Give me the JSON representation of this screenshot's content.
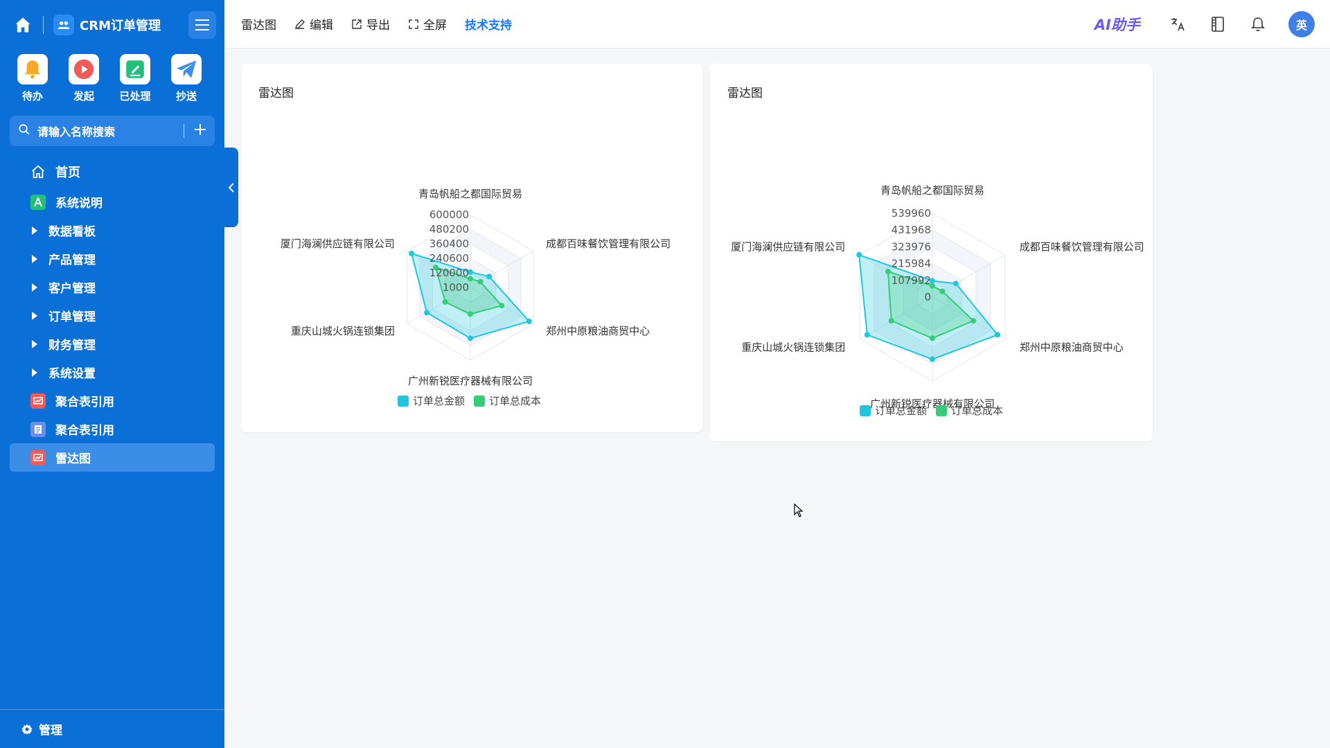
{
  "app": {
    "title": "CRM订单管理"
  },
  "quick_actions": [
    {
      "label": "待办",
      "icon": "bell-icon"
    },
    {
      "label": "发起",
      "icon": "play-icon"
    },
    {
      "label": "已处理",
      "icon": "processed-icon"
    },
    {
      "label": "抄送",
      "icon": "send-icon"
    }
  ],
  "search": {
    "placeholder": "请输入名称搜索"
  },
  "nav": [
    {
      "label": "首页",
      "icon": "home-icon"
    },
    {
      "label": "系统说明",
      "icon": "doc-a-icon"
    },
    {
      "label": "数据看板",
      "icon": "caret-right-icon"
    },
    {
      "label": "产品管理",
      "icon": "caret-right-icon"
    },
    {
      "label": "客户管理",
      "icon": "caret-right-icon"
    },
    {
      "label": "订单管理",
      "icon": "caret-right-icon"
    },
    {
      "label": "财务管理",
      "icon": "caret-right-icon"
    },
    {
      "label": "系统设置",
      "icon": "caret-right-icon"
    },
    {
      "label": "聚合表引用",
      "icon": "chart-report-icon"
    },
    {
      "label": "聚合表引用",
      "icon": "file-icon"
    },
    {
      "label": "雷达图",
      "icon": "chart-report-icon",
      "active": true
    }
  ],
  "footer": {
    "label": "管理"
  },
  "toolbar": {
    "page_title": "雷达图",
    "edit": "编辑",
    "export": "导出",
    "fullscreen": "全屏",
    "support": "技术支持",
    "ai": "AI助手",
    "avatar": "英"
  },
  "colors": {
    "sidebar": "#0b6fd8",
    "series1": "#1ec6e0",
    "series2": "#35cc7a",
    "accent": "#1677ff"
  },
  "chart_data": [
    {
      "type": "radar",
      "title": "雷达图",
      "indicators": [
        "青岛帆船之都国际贸易",
        "成都百味餐饮管理有限公司",
        "郑州中原粮油商贸中心",
        "广州新锐医疗器械有限公司",
        "重庆山城火锅连锁集团",
        "厦门海澜供应链有限公司"
      ],
      "ticks": [
        "1000",
        "120000",
        "240600",
        "360400",
        "480200",
        "600000"
      ],
      "range": [
        1000,
        600000
      ],
      "series": [
        {
          "name": "订单总金额",
          "values": [
            128000,
            180000,
            560000,
            420000,
            415000,
            560000
          ]
        },
        {
          "name": "订单总成本",
          "values": [
            73000,
            95000,
            300000,
            220000,
            240000,
            330000
          ]
        }
      ],
      "legend": "bottom"
    },
    {
      "type": "radar",
      "title": "雷达图",
      "indicators": [
        "青岛帆船之都国际贸易",
        "成都百味餐饮管理有限公司",
        "郑州中原粮油商贸中心",
        "广州新锐医疗器械有限公司",
        "重庆山城火锅连锁集团",
        "厦门海澜供应链有限公司"
      ],
      "ticks": [
        "0",
        "107992",
        "215984",
        "323976",
        "431968",
        "539960"
      ],
      "range": [
        0,
        539960
      ],
      "series": [
        {
          "name": "订单总金额",
          "values": [
            105000,
            175000,
            485000,
            400000,
            485000,
            545000
          ]
        },
        {
          "name": "订单总成本",
          "values": [
            72000,
            75000,
            305000,
            265000,
            305000,
            330000
          ]
        }
      ],
      "legend": "bottom"
    }
  ]
}
